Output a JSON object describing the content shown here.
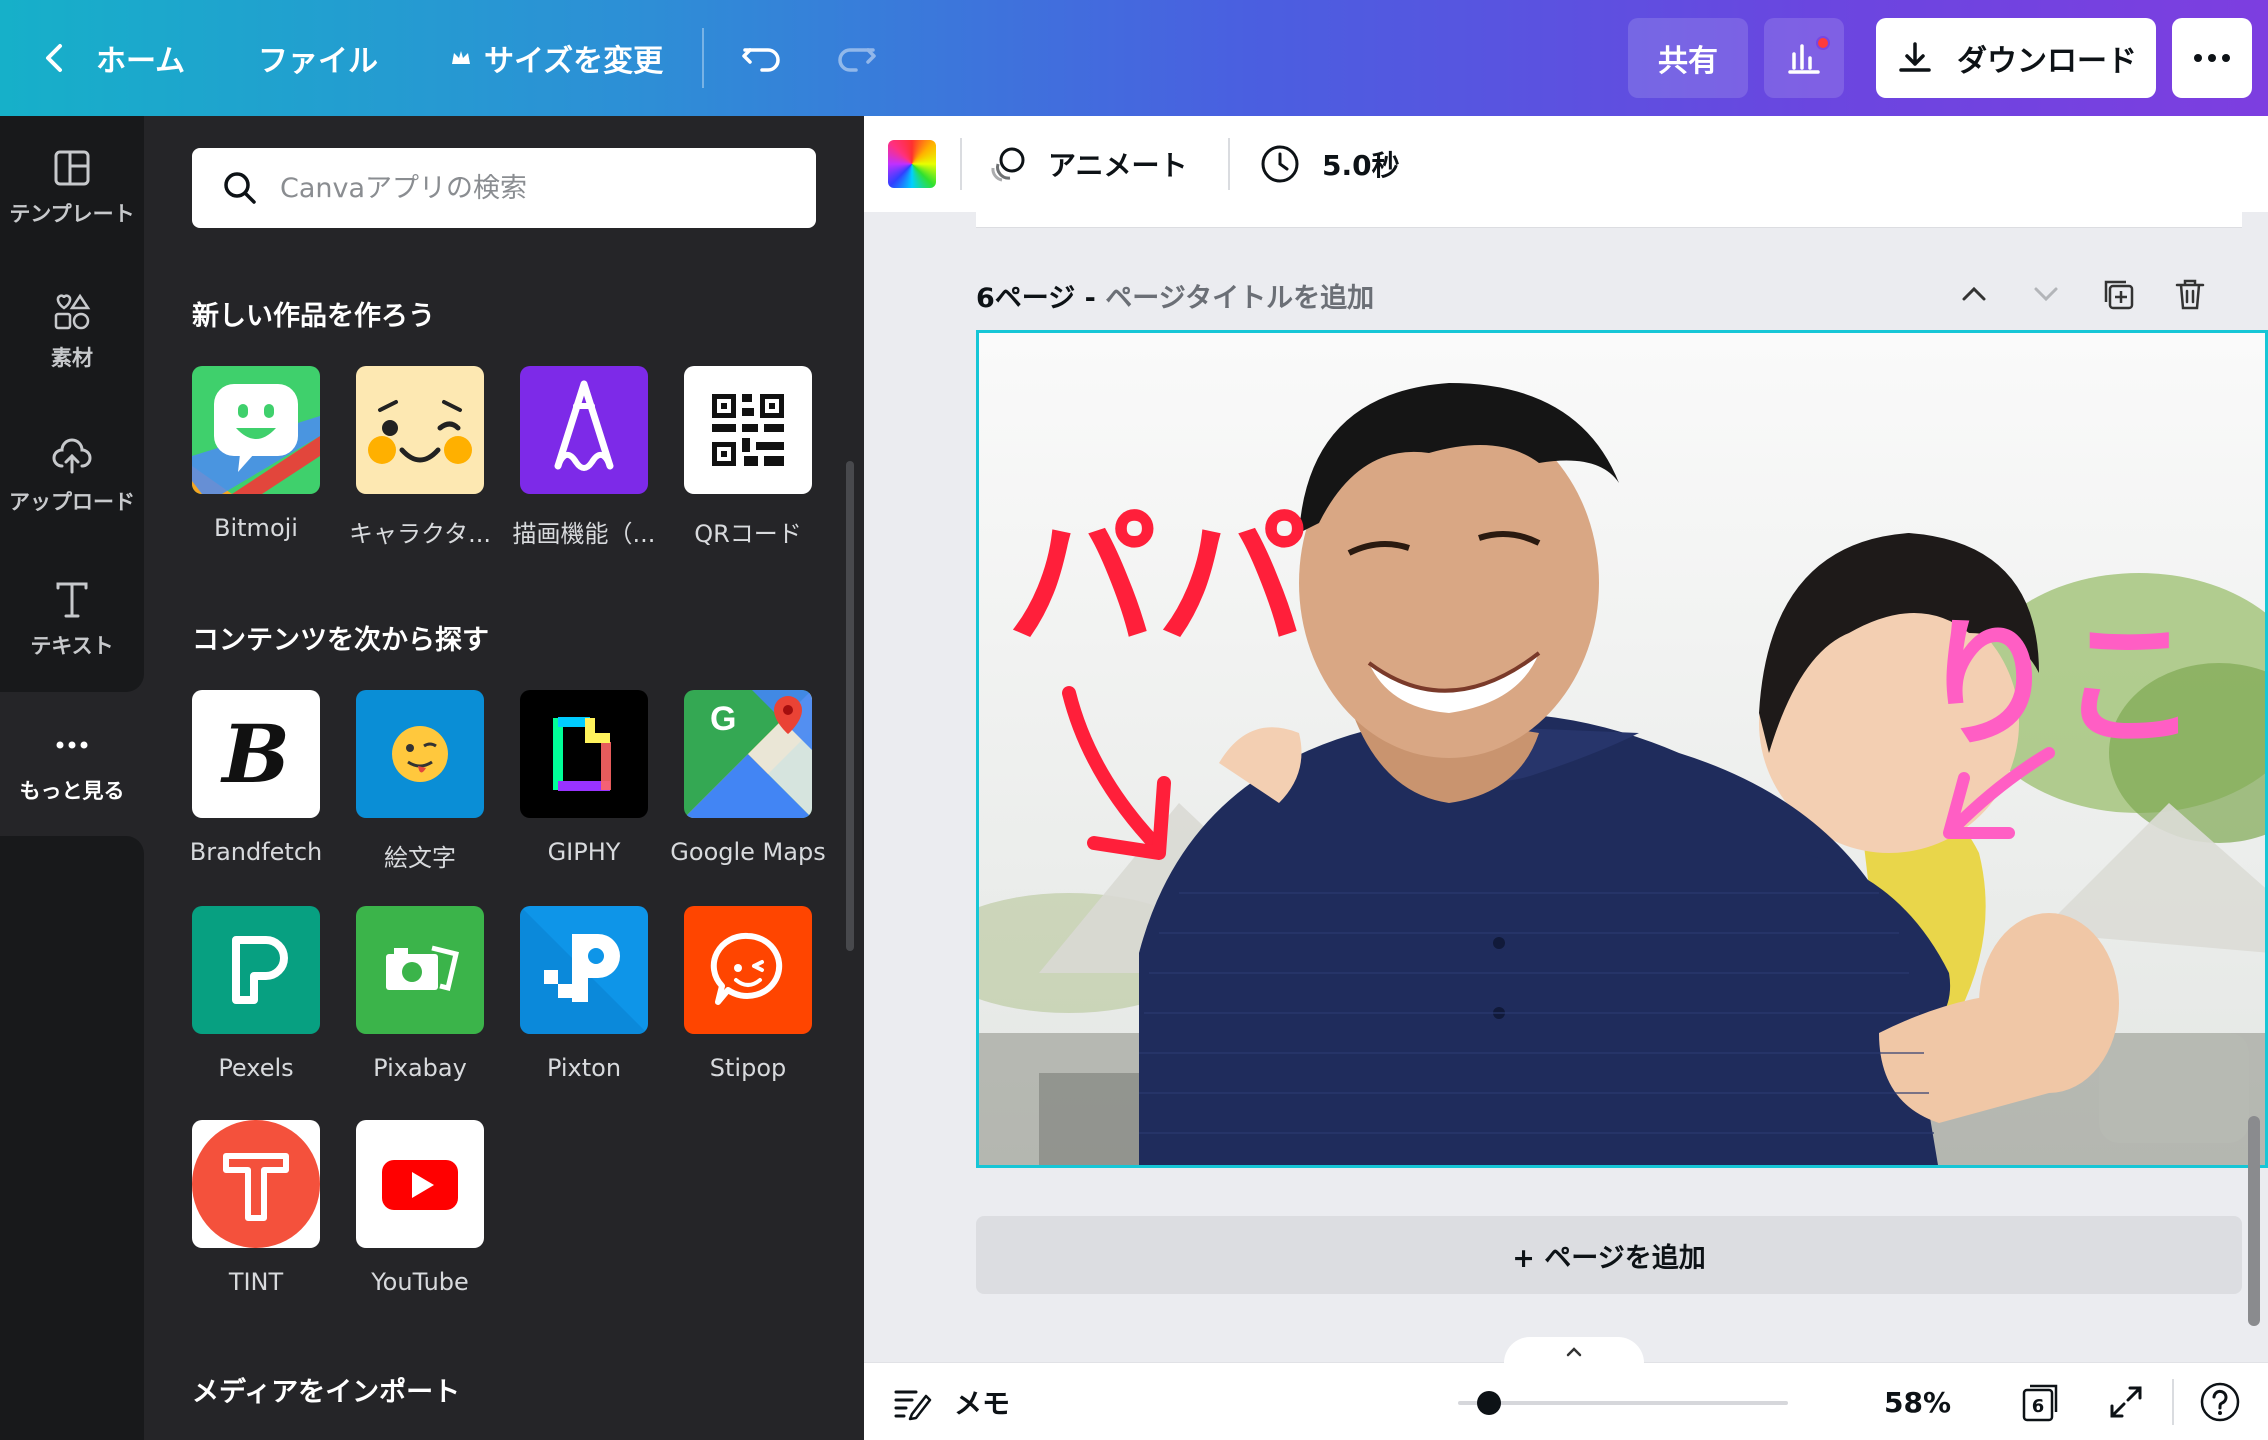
{
  "topbar": {
    "home_label": "ホーム",
    "file_label": "ファイル",
    "resize_label": "サイズを変更",
    "share_label": "共有",
    "download_label": "ダウンロード"
  },
  "rail": {
    "items": [
      {
        "label": "テンプレート",
        "icon": "template-icon"
      },
      {
        "label": "素材",
        "icon": "elements-icon"
      },
      {
        "label": "アップロード",
        "icon": "upload-cloud-icon"
      },
      {
        "label": "テキスト",
        "icon": "text-icon"
      },
      {
        "label": "もっと見る",
        "icon": "more-dots-icon"
      }
    ]
  },
  "panel": {
    "search_placeholder": "Canvaアプリの検索",
    "section_create": "新しい作品を作ろう",
    "section_discover": "コンテンツを次から探す",
    "section_import": "メディアをインポート",
    "create_apps": [
      {
        "label": "Bitmoji"
      },
      {
        "label": "キャラクタ..."
      },
      {
        "label": "描画機能（..."
      },
      {
        "label": "QRコード"
      }
    ],
    "discover_apps": [
      {
        "label": "Brandfetch"
      },
      {
        "label": "絵文字"
      },
      {
        "label": "GIPHY"
      },
      {
        "label": "Google Maps"
      },
      {
        "label": "Pexels"
      },
      {
        "label": "Pixabay"
      },
      {
        "label": "Pixton"
      },
      {
        "label": "Stipop"
      },
      {
        "label": "TINT"
      },
      {
        "label": "YouTube"
      }
    ]
  },
  "context_bar": {
    "animate_label": "アニメート",
    "duration_label": "5.0秒"
  },
  "page": {
    "number_label": "6ページ - ",
    "title_placeholder": "ページタイトルを追加",
    "add_page_label": "+ ページを追加"
  },
  "canvas": {
    "annotation_left": "パパ",
    "annotation_right": "りこ"
  },
  "bottom": {
    "notes_label": "メモ",
    "zoom_label": "58%",
    "page_count": "6",
    "zoom_level": 0.1
  },
  "colors": {
    "accent_cyan": "#16c6d6",
    "annotation_red": "#ff1f3a",
    "annotation_pink": "#ff5ec4"
  }
}
